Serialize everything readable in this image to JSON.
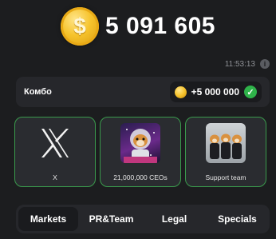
{
  "balance": {
    "value": "5 091 605",
    "coin_icon": "dollar-coin-icon"
  },
  "status": {
    "time": "11:53:13",
    "info_icon": "i"
  },
  "combo": {
    "label": "Комбо",
    "reward": "+5 000 000",
    "completed": true,
    "check_color": "#2fb34a"
  },
  "cards": [
    {
      "caption": "X",
      "image": "x-logo"
    },
    {
      "caption": "21,000,000 CEOs",
      "image": "astronaut-hamster"
    },
    {
      "caption": "Support team",
      "image": "hamster-team"
    }
  ],
  "tabs": [
    {
      "label": "Markets",
      "active": true
    },
    {
      "label": "PR&Team",
      "active": false
    },
    {
      "label": "Legal",
      "active": false
    },
    {
      "label": "Specials",
      "active": false
    }
  ],
  "colors": {
    "background": "#1c1d1f",
    "card_border": "#3a9a4c",
    "coin": "#f6c32c"
  }
}
